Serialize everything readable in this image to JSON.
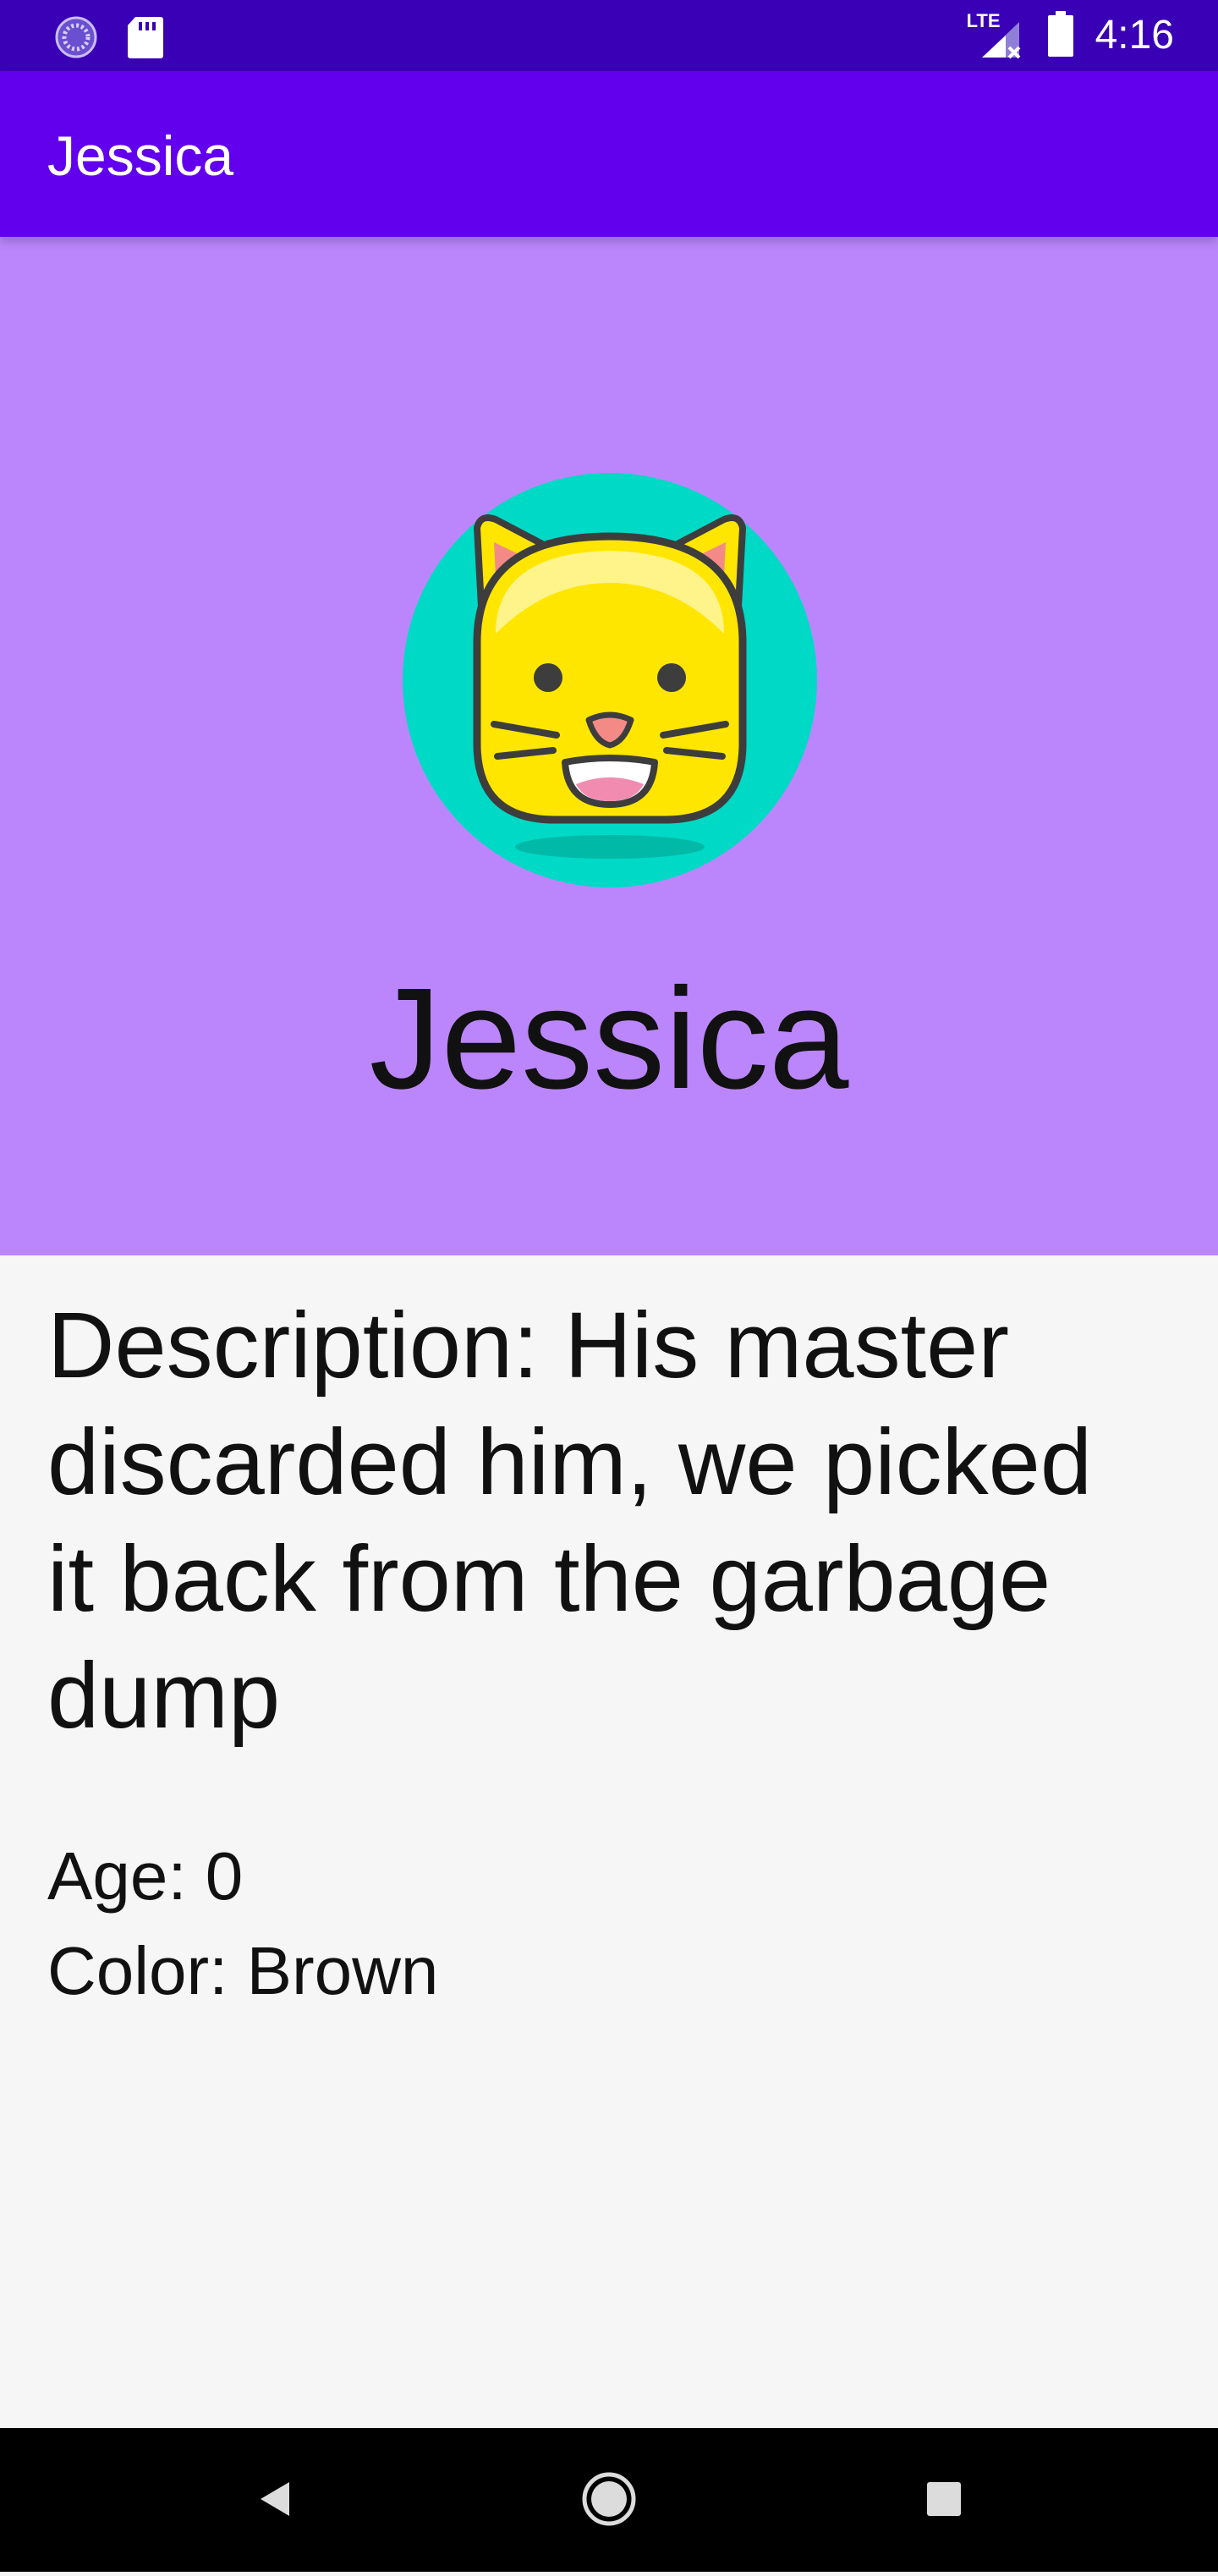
{
  "status_bar": {
    "time": "4:16",
    "network_label": "LTE",
    "icons": [
      "loading-spinner-icon",
      "sd-card-icon",
      "signal-icon",
      "battery-icon"
    ]
  },
  "app_bar": {
    "title": "Jessica"
  },
  "profile": {
    "name": "Jessica",
    "avatar_icon": "cat-face-icon",
    "description": "Description: His master discarded him, we picked it back from the garbage dump",
    "age": "Age: 0",
    "color": "Color: Brown"
  },
  "nav_bar": {
    "icons": [
      "back-icon",
      "home-icon",
      "recents-icon"
    ]
  },
  "colors": {
    "status_bar": "#3a00b5",
    "app_bar": "#6200ee",
    "hero_bg": "#bb86fc",
    "content_bg": "#f6f6f6",
    "avatar_circle": "#00d9c5",
    "cat_face": "#ffe600"
  }
}
